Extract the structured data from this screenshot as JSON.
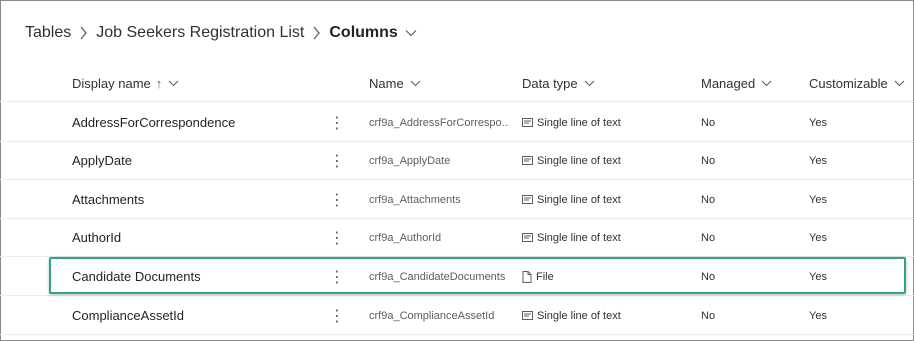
{
  "breadcrumb": {
    "items": [
      "Tables",
      "Job Seekers Registration List"
    ],
    "current": "Columns"
  },
  "columns": {
    "display_name": "Display name",
    "sort_indicator": "↑",
    "name": "Name",
    "data_type": "Data type",
    "managed": "Managed",
    "customizable": "Customizable"
  },
  "rows": [
    {
      "display_name": "AddressForCorrespondence",
      "more": "⋮",
      "name": "crf9a_AddressForCorrespo...",
      "type_icon": "text-field-icon",
      "data_type": "Single line of text",
      "managed": "No",
      "customizable": "Yes"
    },
    {
      "display_name": "ApplyDate",
      "more": "⋮",
      "name": "crf9a_ApplyDate",
      "type_icon": "text-field-icon",
      "data_type": "Single line of text",
      "managed": "No",
      "customizable": "Yes"
    },
    {
      "display_name": "Attachments",
      "more": "⋮",
      "name": "crf9a_Attachments",
      "type_icon": "text-field-icon",
      "data_type": "Single line of text",
      "managed": "No",
      "customizable": "Yes"
    },
    {
      "display_name": "AuthorId",
      "more": "⋮",
      "name": "crf9a_AuthorId",
      "type_icon": "text-field-icon",
      "data_type": "Single line of text",
      "managed": "No",
      "customizable": "Yes"
    },
    {
      "display_name": "Candidate Documents",
      "more": "⋮",
      "name": "crf9a_CandidateDocuments",
      "type_icon": "file-icon",
      "data_type": "File",
      "managed": "No",
      "customizable": "Yes"
    },
    {
      "display_name": "ComplianceAssetId",
      "more": "⋮",
      "name": "crf9a_ComplianceAssetId",
      "type_icon": "text-field-icon",
      "data_type": "Single line of text",
      "managed": "No",
      "customizable": "Yes"
    }
  ],
  "highlight_color": "#2fa38a"
}
